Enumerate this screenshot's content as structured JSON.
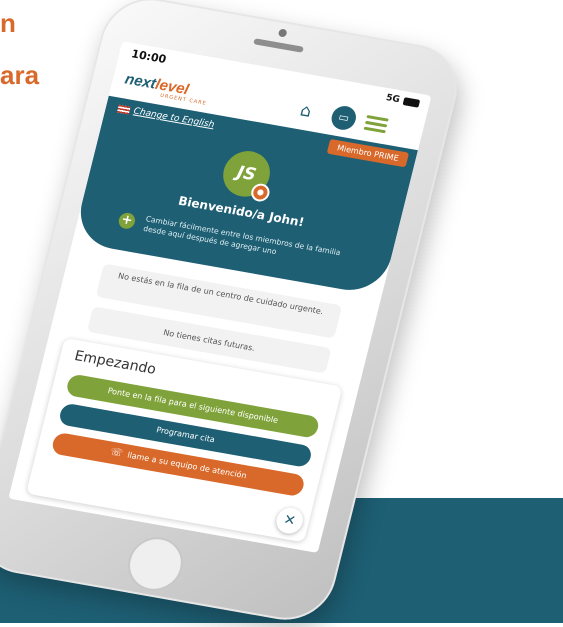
{
  "background": {
    "headline_line_1": "n",
    "headline_line_2": "ara",
    "accent_color": "#d9692a",
    "band_color": "#1e5f74"
  },
  "status_bar": {
    "time": "10:00",
    "signal": "5G"
  },
  "app_bar": {
    "logo_text_main": "next",
    "logo_text_accent": "level",
    "logo_subtitle": "URGENT CARE",
    "icons": [
      "home-icon",
      "chat-icon",
      "menu-icon"
    ]
  },
  "hero": {
    "language_link": "Change to English",
    "membership_badge": "Miembro PRIME",
    "avatar_initials": "JS",
    "welcome": "Bienvenido/a John!",
    "switch_member_text": "Cambiar fácilmente entre los miembros de la familia desde aquí después de agregar uno"
  },
  "status_cards": {
    "queue": "No estás en la fila de un centro de cuidado urgente.",
    "appointments": "No tienes citas futuras."
  },
  "getting_started": {
    "title": "Empezando",
    "join_queue": "Ponte en la fila para el siguiente disponible",
    "schedule": "Programar cita",
    "call_team": "llame a su equipo de atención"
  },
  "colors": {
    "teal": "#1e5f74",
    "green": "#7fa33a",
    "orange": "#d9692a"
  }
}
